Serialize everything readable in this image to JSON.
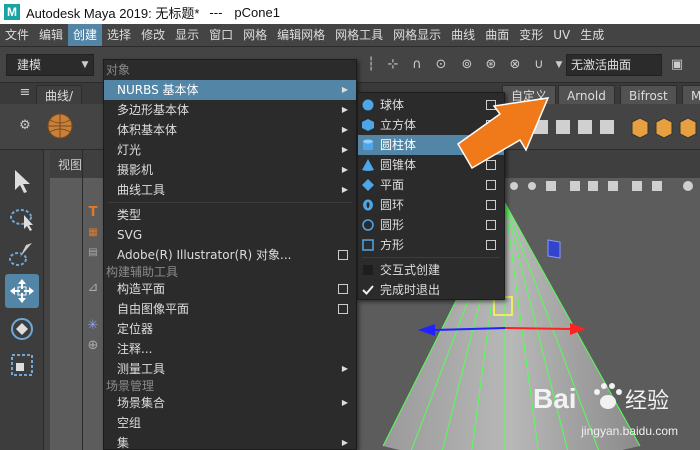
{
  "window": {
    "title_app": "Autodesk Maya 2019: 无标题*",
    "title_sep": "---",
    "title_object": "pCone1"
  },
  "menubar": [
    "文件",
    "编辑",
    "创建",
    "选择",
    "修改",
    "显示",
    "窗口",
    "网格",
    "编辑网格",
    "网格工具",
    "网格显示",
    "曲线",
    "曲面",
    "变形",
    "UV",
    "生成"
  ],
  "menubar_active": "创建",
  "toolbar": {
    "mode_select": "建模",
    "no_active_surface": "无激活曲面"
  },
  "shelf_tabs": {
    "curves": "曲线/",
    "custom": "自定义",
    "arnold": "Arnold",
    "bifrost": "Bifrost",
    "m": "M"
  },
  "viewport": {
    "label": "视图"
  },
  "create_menu": {
    "sections": {
      "objects": "对象",
      "construction": "构建辅助工具",
      "scene": "场景管理"
    },
    "items": {
      "nurbs": "NURBS 基本体",
      "poly": "多边形基本体",
      "volume": "体积基本体",
      "lights": "灯光",
      "cameras": "摄影机",
      "curve_tools": "曲线工具",
      "type": "类型",
      "svg": "SVG",
      "illustrator": "Adobe(R) Illustrator(R) 对象...",
      "construction_plane": "构造平面",
      "free_image_plane": "自由图像平面",
      "locator": "定位器",
      "annotation": "注释...",
      "measure": "测量工具",
      "scene_sets": "场景集合",
      "empty_group": "空组",
      "sets": "集"
    }
  },
  "nurbs_submenu": {
    "items": {
      "sphere": "球体",
      "cube": "立方体",
      "cylinder": "圆柱体",
      "cone": "圆锥体",
      "plane": "平面",
      "torus": "圆环",
      "circle": "圆形",
      "square": "方形",
      "interactive": "交互式创建",
      "exit_on_complete": "完成时退出"
    },
    "highlighted": "圆柱体",
    "exit_on_complete_checked": true
  },
  "watermark": {
    "brand": "Bai 经验",
    "url": "jingyan.baidu.com"
  },
  "colors": {
    "highlight": "#5285a6",
    "arrow": "#f07a1a",
    "wireframe": "#55ff55",
    "menu_bg": "#2b2b2b"
  }
}
